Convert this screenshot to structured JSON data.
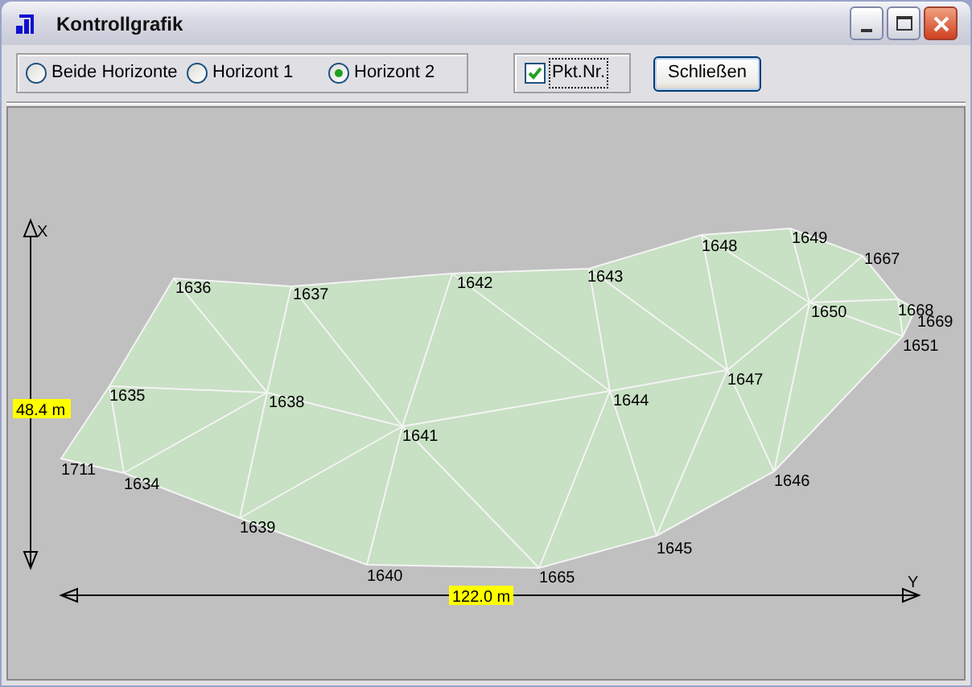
{
  "window": {
    "title": "Kontrollgrafik"
  },
  "horizon_options": [
    {
      "label": "Beide Horizonte",
      "selected": false
    },
    {
      "label": "Horizont 1",
      "selected": false
    },
    {
      "label": "Horizont 2",
      "selected": true
    }
  ],
  "point_numbers_checkbox": {
    "label": "Pkt.Nr.",
    "checked": true
  },
  "close_button": {
    "label": "Schließen"
  },
  "plot": {
    "y_axis": {
      "label": "X",
      "length": "48.4 m"
    },
    "x_axis": {
      "label": "Y",
      "length": "122.0 m"
    },
    "points": [
      "1636",
      "1637",
      "1642",
      "1643",
      "1648",
      "1649",
      "1667",
      "1668",
      "1669",
      "1651",
      "1650",
      "1647",
      "1644",
      "1646",
      "1645",
      "1665",
      "1640",
      "1639",
      "1634",
      "1711",
      "1635",
      "1638",
      "1641"
    ]
  }
}
